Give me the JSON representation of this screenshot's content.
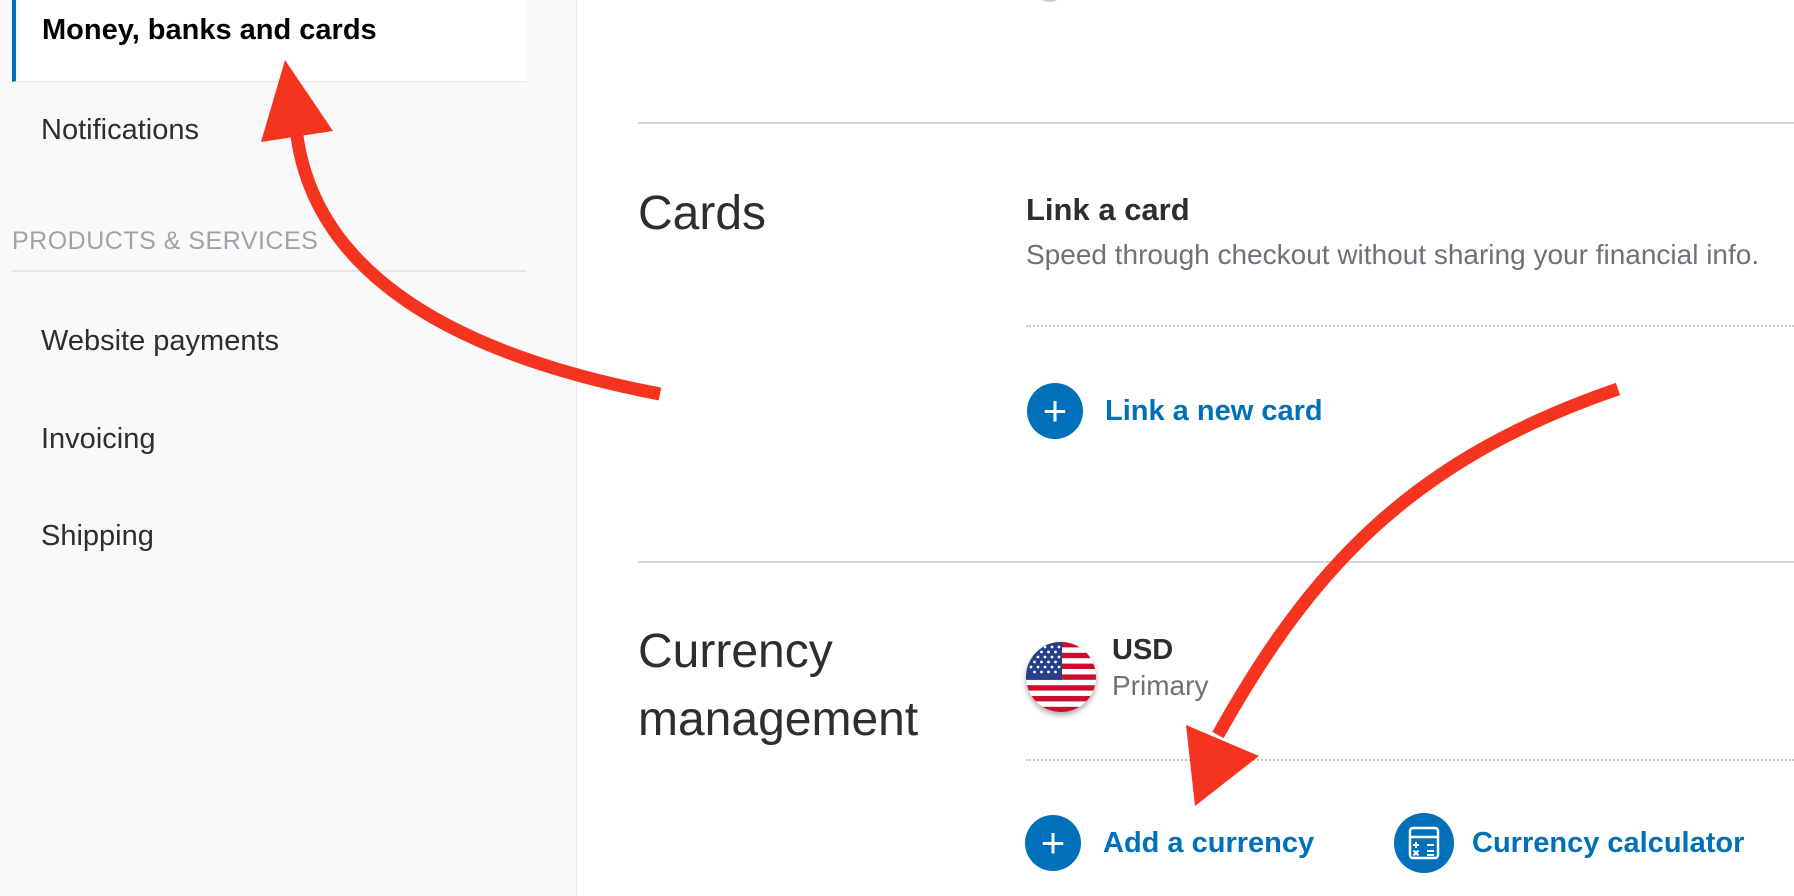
{
  "sidebar": {
    "active_item": "Money, banks and cards",
    "items_top": [
      "Notifications"
    ],
    "section_label": "PRODUCTS & SERVICES",
    "items_products": [
      "Website payments",
      "Invoicing",
      "Shipping"
    ]
  },
  "main": {
    "cards": {
      "title": "Cards",
      "heading": "Link a card",
      "description": "Speed through checkout without sharing your financial info.",
      "link_new_card": "Link a new card"
    },
    "currency": {
      "title_line1": "Currency",
      "title_line2": "management",
      "code": "USD",
      "status": "Primary",
      "add_currency": "Add a currency",
      "calculator": "Currency calculator"
    }
  },
  "icons": {
    "plus": "plus-icon",
    "calculator": "calculator-icon",
    "flag": "us-flag-icon"
  },
  "colors": {
    "accent": "#0070ba",
    "annotation_arrow": "#f5341f"
  }
}
